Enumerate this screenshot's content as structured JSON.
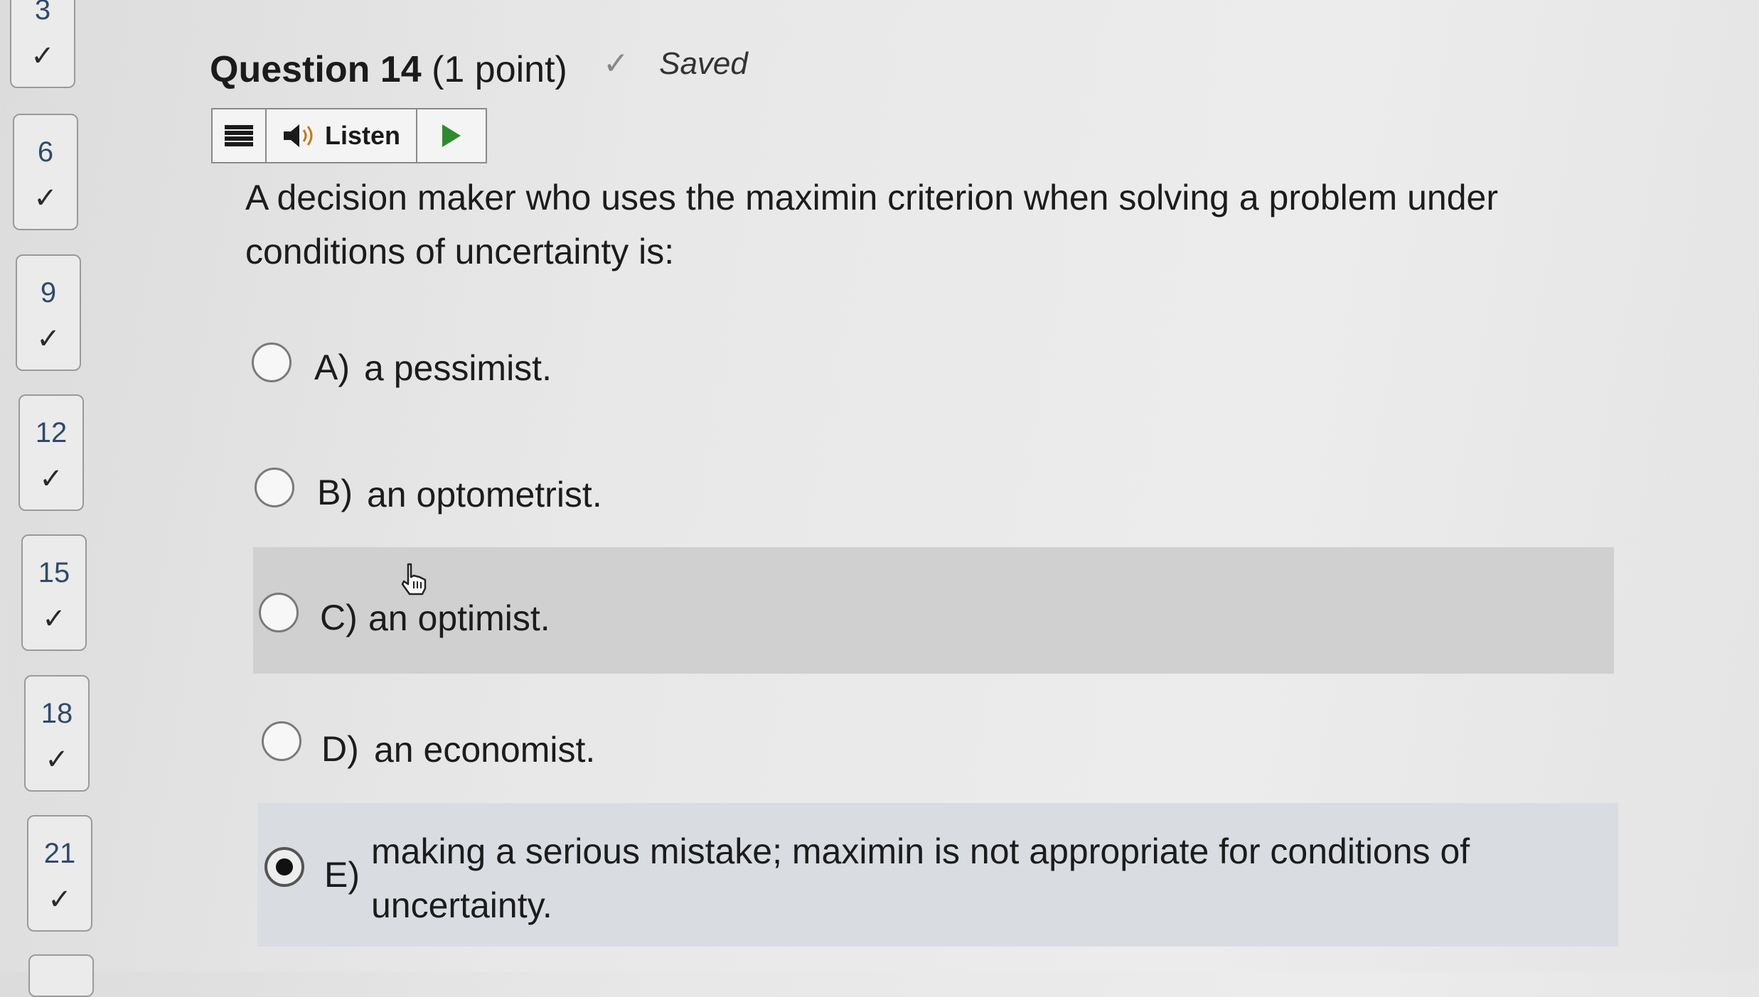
{
  "navigator": {
    "tiles": [
      {
        "number": "3"
      },
      {
        "number": "6"
      },
      {
        "number": "9"
      },
      {
        "number": "12"
      },
      {
        "number": "15"
      },
      {
        "number": "18"
      },
      {
        "number": "21"
      }
    ],
    "check_glyph": "✓"
  },
  "header": {
    "question_label": "Question 14",
    "points": "(1 point)",
    "saved_icon": "✓",
    "saved_label": "Saved"
  },
  "listen_toolbar": {
    "menu_icon": "hamburger-icon",
    "speaker_icon": "speaker-icon",
    "listen_label": "Listen",
    "play_icon": "play-icon"
  },
  "question": {
    "line1": "A decision maker who uses the maximin criterion when solving a problem under",
    "line2": "conditions of uncertainty is:"
  },
  "options": [
    {
      "letter": "A)",
      "text": "a pessimist.",
      "selected": false
    },
    {
      "letter": "B)",
      "text": "an optometrist.",
      "selected": false
    },
    {
      "letter": "C)",
      "text": "an optimist.",
      "selected": false
    },
    {
      "letter": "D)",
      "text": "an economist.",
      "selected": false
    },
    {
      "letter": "E)",
      "text_line1": "making a serious mistake; maximin is not appropriate for conditions of",
      "text_line2": "uncertainty.",
      "selected": true
    }
  ],
  "colors": {
    "hover_row": "#d0d0d0",
    "selected_row": "#d9dde2",
    "play_green": "#2e8b2e",
    "nav_number": "#2f4a6a"
  }
}
